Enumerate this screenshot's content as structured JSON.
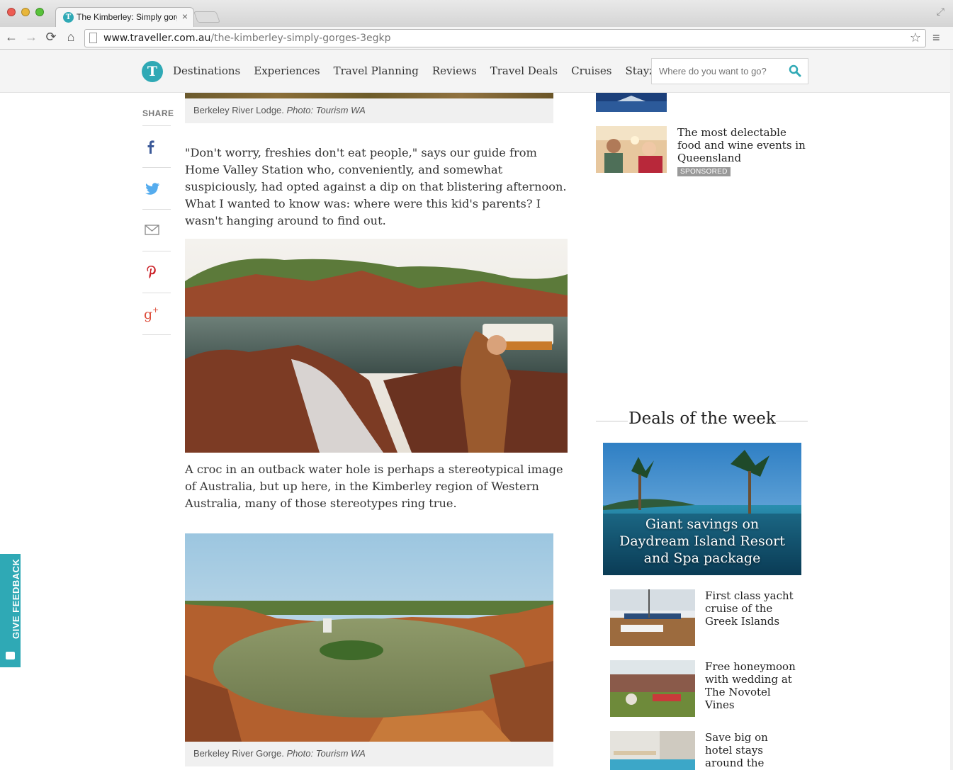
{
  "browser": {
    "tab_title": "The Kimberley: Simply gorges",
    "tab_close": "×",
    "url_domain": "www.traveller.com.au",
    "url_path": "/the-kimberley-simply-gorges-3egkp",
    "back": "←",
    "forward": "→",
    "reload": "⟳",
    "home": "⌂",
    "star": "☆",
    "menu": "≡",
    "fullscreen": "⤢"
  },
  "site": {
    "logo": "T",
    "nav": [
      "Destinations",
      "Experiences",
      "Travel Planning",
      "Reviews",
      "Travel Deals",
      "Cruises",
      "Stayz"
    ],
    "search_placeholder": "Where do you want to go?",
    "accent_color": "#2fa9b5"
  },
  "share": {
    "label": "SHARE",
    "items": [
      "facebook-icon",
      "twitter-icon",
      "email-icon",
      "pinterest-icon",
      "google-plus-icon"
    ]
  },
  "article": {
    "caption1_text": "Berkeley River Lodge. ",
    "caption1_credit": "Photo: Tourism WA",
    "para1": "\"Don't worry, freshies don't eat people,\" says our guide from Home Valley Station who, conveniently, and somewhat suspiciously, had opted against a dip on that blistering afternoon. What I wanted to know was: where were this kid's parents? I wasn't hanging around to find out.",
    "para2": "A croc in an outback water hole is perhaps a stereotypical image of Australia, but up here, in the Kimberley region of Western Australia, many of those stereotypes ring true.",
    "caption2_text": "Berkeley River Gorge. ",
    "caption2_credit": "Photo: Tourism WA"
  },
  "sidebar": {
    "story_title": "The most delectable food and wine events in Queensland",
    "sponsored": "SPONSORED",
    "deals_heading": "Deals of the week",
    "main_deal": "Giant savings on Daydream Island Resort and Spa package",
    "deals": [
      "First class yacht cruise of the Greek Islands",
      "Free honeymoon with wedding at The Novotel Vines",
      "Save big on hotel stays around the world"
    ]
  },
  "feedback": {
    "label": "GIVE FEEDBACK"
  }
}
